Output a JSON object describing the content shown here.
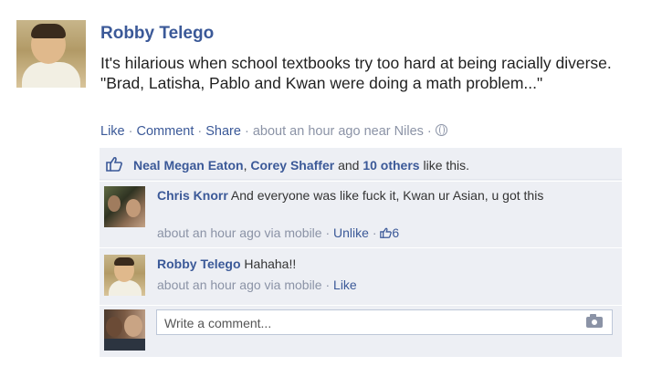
{
  "post": {
    "author": "Robby Telego",
    "text": "It's hilarious when school textbooks try too hard at being racially diverse. \"Brad, Latisha, Pablo and Kwan were doing a math problem...\"",
    "actions": {
      "like": "Like",
      "sep": " · ",
      "comment": "Comment",
      "share": "Share",
      "time": "about an hour ago",
      "location_prefix": "near",
      "location": "Niles",
      "privacy_icon": "globe-icon"
    }
  },
  "likes": {
    "icon": "thumbs-up-icon",
    "name1": "Neal Megan Eaton",
    "comma": ", ",
    "name2": "Corey Shaffer",
    "and": " and ",
    "others": "10 others",
    "suffix": " like this."
  },
  "comments": [
    {
      "author": "Chris Knorr",
      "text": "And everyone was like fuck it, Kwan ur Asian, u got this",
      "time": "about an hour ago via mobile",
      "action": "Unlike",
      "like_count": "6",
      "like_icon": "thumbs-up-icon"
    },
    {
      "author": "Robby Telego",
      "text": "Hahaha!!",
      "time": "about an hour ago via mobile",
      "action": "Like"
    }
  ],
  "comment_box": {
    "placeholder": "Write a comment...",
    "icon": "camera-icon"
  },
  "colors": {
    "link": "#3b5998",
    "meta": "#8b93a6",
    "ufi_background": "#edeff4",
    "input_border": "#bdc7d8"
  }
}
